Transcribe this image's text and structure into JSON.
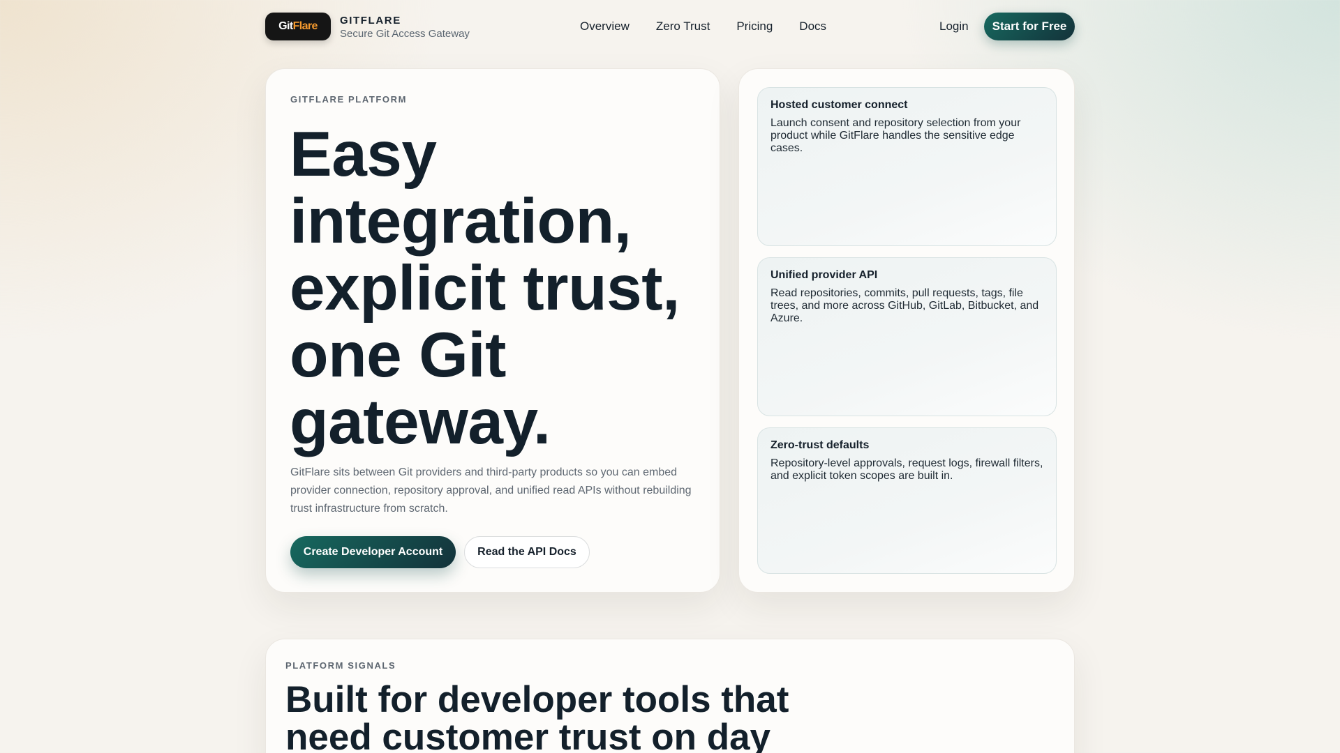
{
  "nav": {
    "logo": {
      "part1": "Git",
      "part2": "Flare"
    },
    "brand_name": "GITFLARE",
    "brand_subtitle": "Secure Git Access Gateway",
    "links": [
      "Overview",
      "Zero Trust",
      "Pricing",
      "Docs"
    ],
    "login": "Login",
    "start_button": "Start for Free"
  },
  "hero": {
    "eyebrow": "GITFLARE PLATFORM",
    "title": "Easy integration, explicit trust, one Git gateway.",
    "description": "GitFlare sits between Git providers and third-party products so you can embed provider connection, repository approval, and unified read APIs without rebuilding trust infrastructure from scratch.",
    "primary_button": "Create Developer Account",
    "secondary_button": "Read the API Docs"
  },
  "features": [
    {
      "title": "Hosted customer connect",
      "text": "Launch consent and repository selection from your product while GitFlare handles the sensitive edge cases."
    },
    {
      "title": "Unified provider API",
      "text": "Read repositories, commits, pull requests, tags, file trees, and more across GitHub, GitLab, Bitbucket, and Azure."
    },
    {
      "title": "Zero-trust defaults",
      "text": "Repository-level approvals, request logs, firewall filters, and explicit token scopes are built in."
    }
  ],
  "signals": {
    "eyebrow": "PLATFORM SIGNALS",
    "title": "Built for developer tools that need customer trust on day"
  },
  "colors": {
    "accent": "#17695f",
    "accent_dark": "#13323a",
    "logo_flare": "#f59a2e",
    "text": "#13202b"
  }
}
